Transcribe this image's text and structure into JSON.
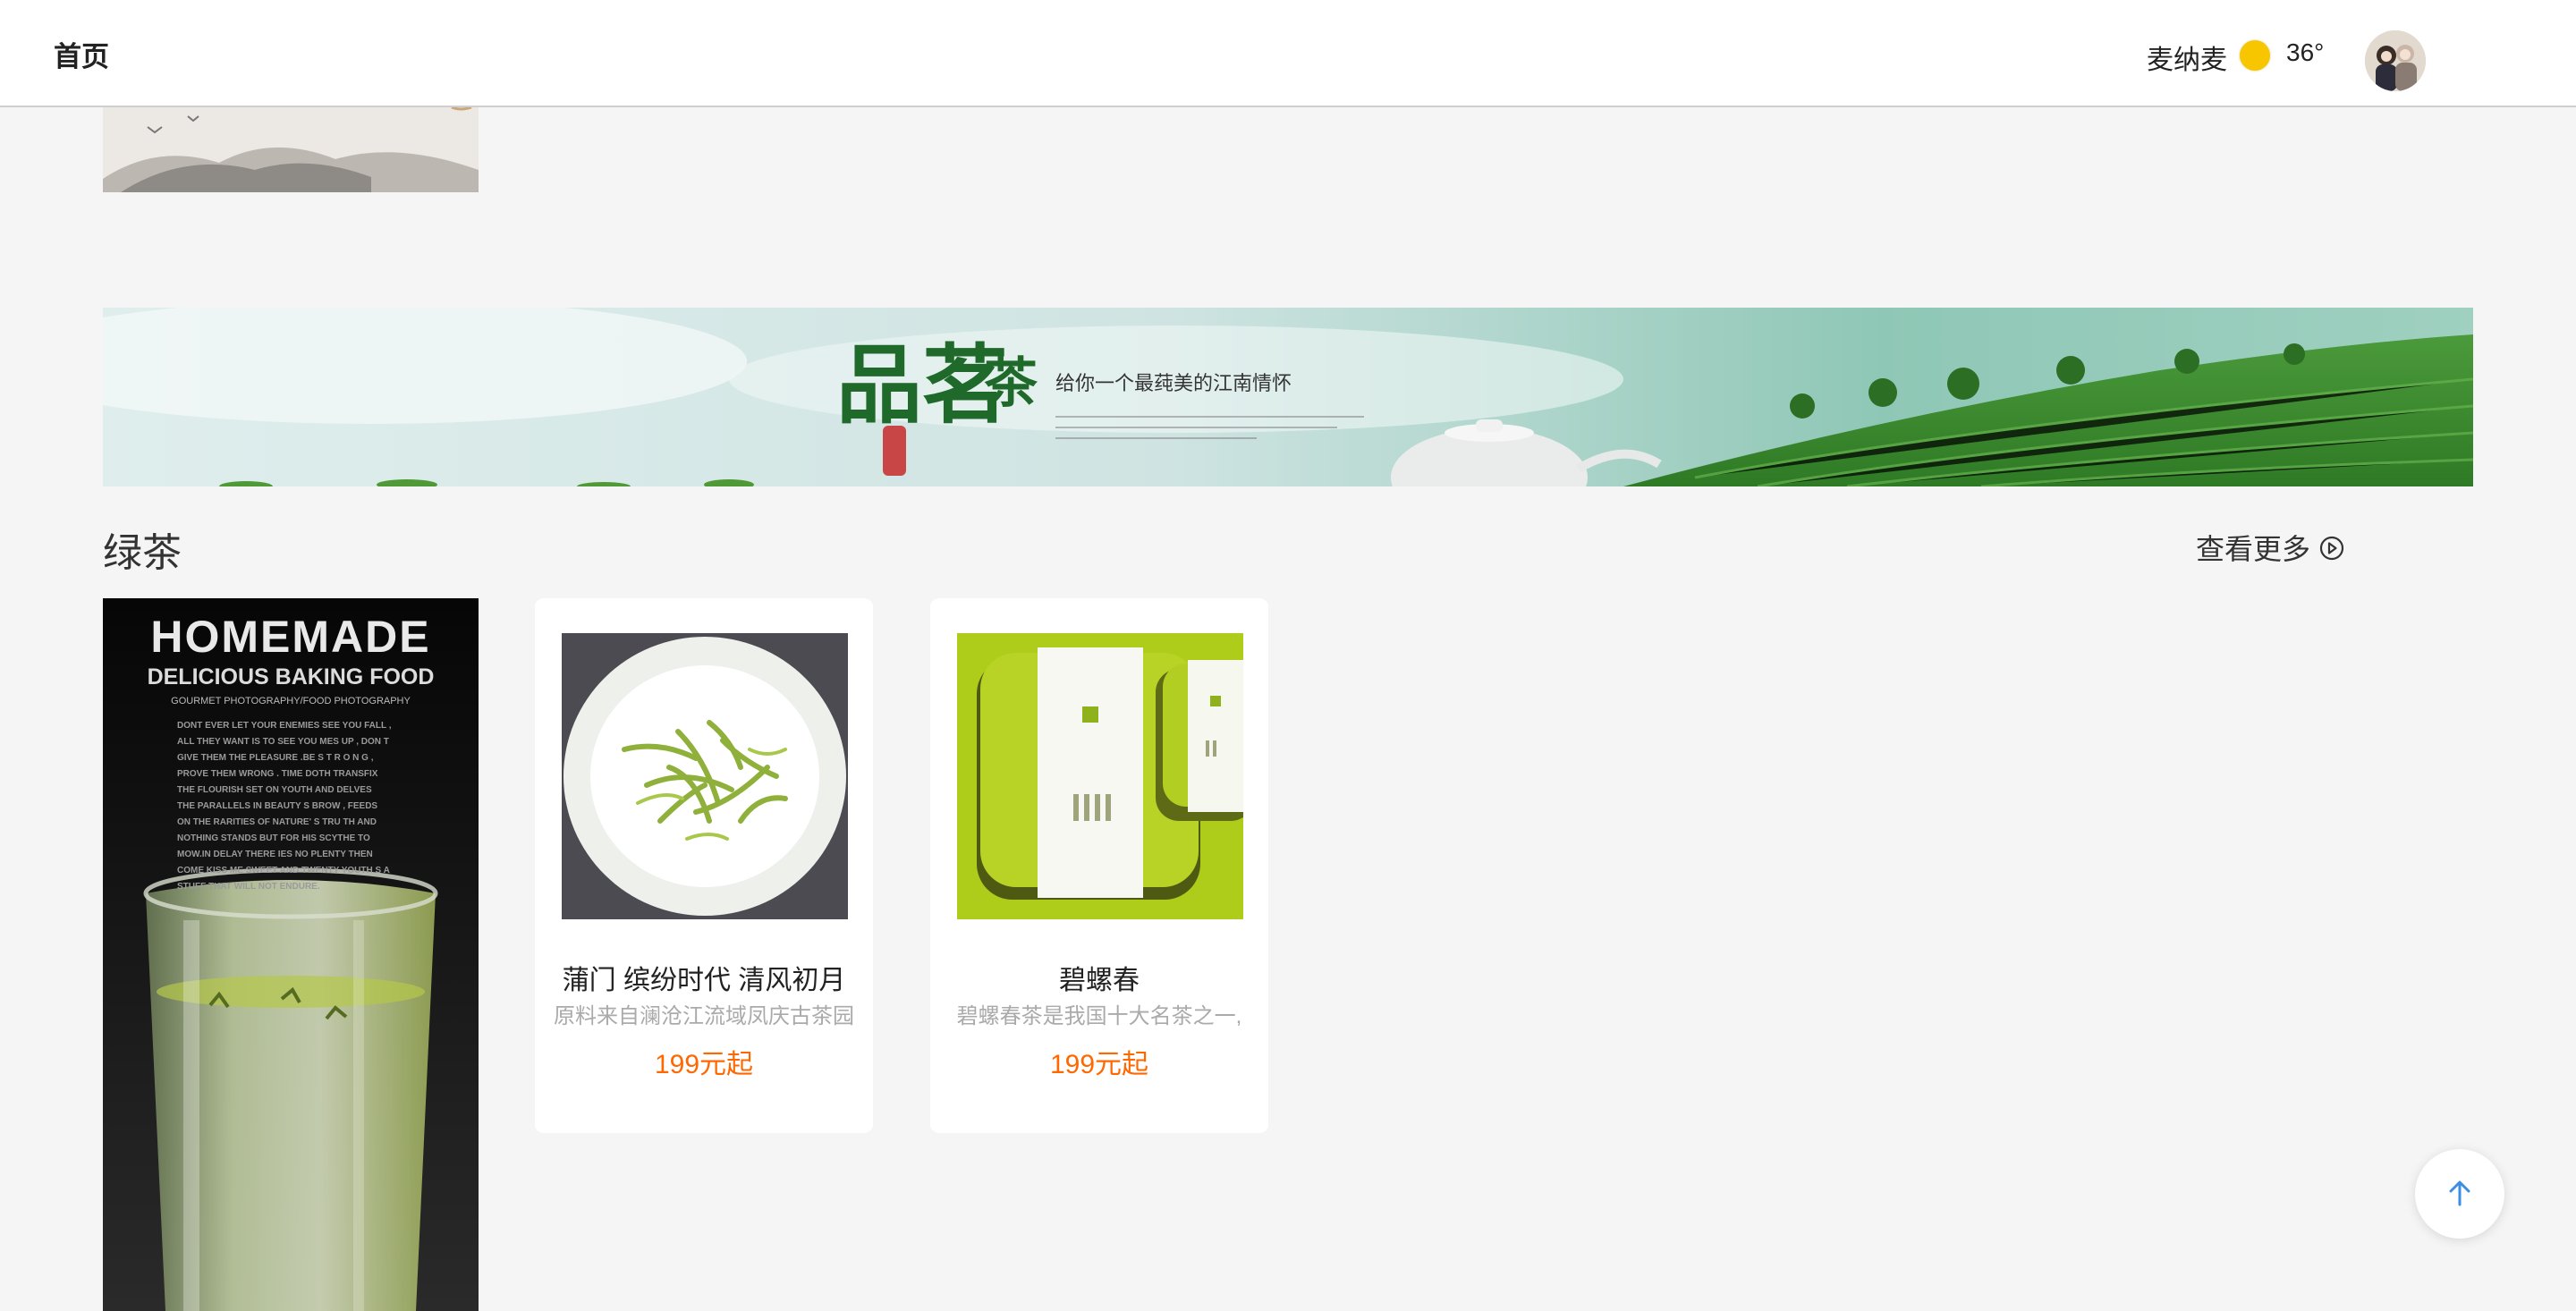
{
  "header": {
    "home_label": "首页",
    "user_name": "麦纳麦",
    "weather_icon": "sun-icon",
    "temperature": "36°"
  },
  "banner": {
    "title_main": "品茗",
    "title_side": "茶",
    "slogan": "给你一个最莼美的江南情怀"
  },
  "section": {
    "title": "绿茶",
    "view_more": "查看更多",
    "view_more_icon": "circle-play-icon"
  },
  "poster": {
    "title": "HOMEMADE",
    "subtitle": "DELICIOUS BAKING FOOD",
    "small": "GOURMET PHOTOGRAPHY/FOOD PHOTOGRAPHY",
    "body": "DONT EVER LET YOUR ENEMIES SEE YOU FALL , ALL THEY WANT IS TO SEE YOU MES UP , DON T GIVE THEM THE PLEASURE .BE S T R O N G , PROVE THEM WRONG . TIME DOTH TRANSFIX THE FLOURISH SET ON YOUTH AND DELVES THE PARALLELS IN BEAUTY S BROW , FEEDS ON THE RARITIES OF NATURE' S TRU TH AND NOTHING STANDS BUT FOR HIS SCYTHE TO MOW.IN DELAY THERE IES NO PLENTY THEN COME KISS ME SWEET AND TWENTY YOUTH S A STUFF THAT WILL NOT ENDURE."
  },
  "products": [
    {
      "name": "蒲门 缤纷时代 清风初月",
      "desc": "原料来自澜沧江流域凤庆古茶园",
      "price": "199元起"
    },
    {
      "name": "碧螺春",
      "desc": "碧螺春茶是我国十大名茶之一,",
      "price": "199元起"
    }
  ],
  "back_to_top_icon": "arrow-up-icon",
  "colors": {
    "price": "#ff6700",
    "page_bg": "#f5f5f5",
    "sun": "#f7c600",
    "back_top_arrow": "#3a8ee6"
  }
}
